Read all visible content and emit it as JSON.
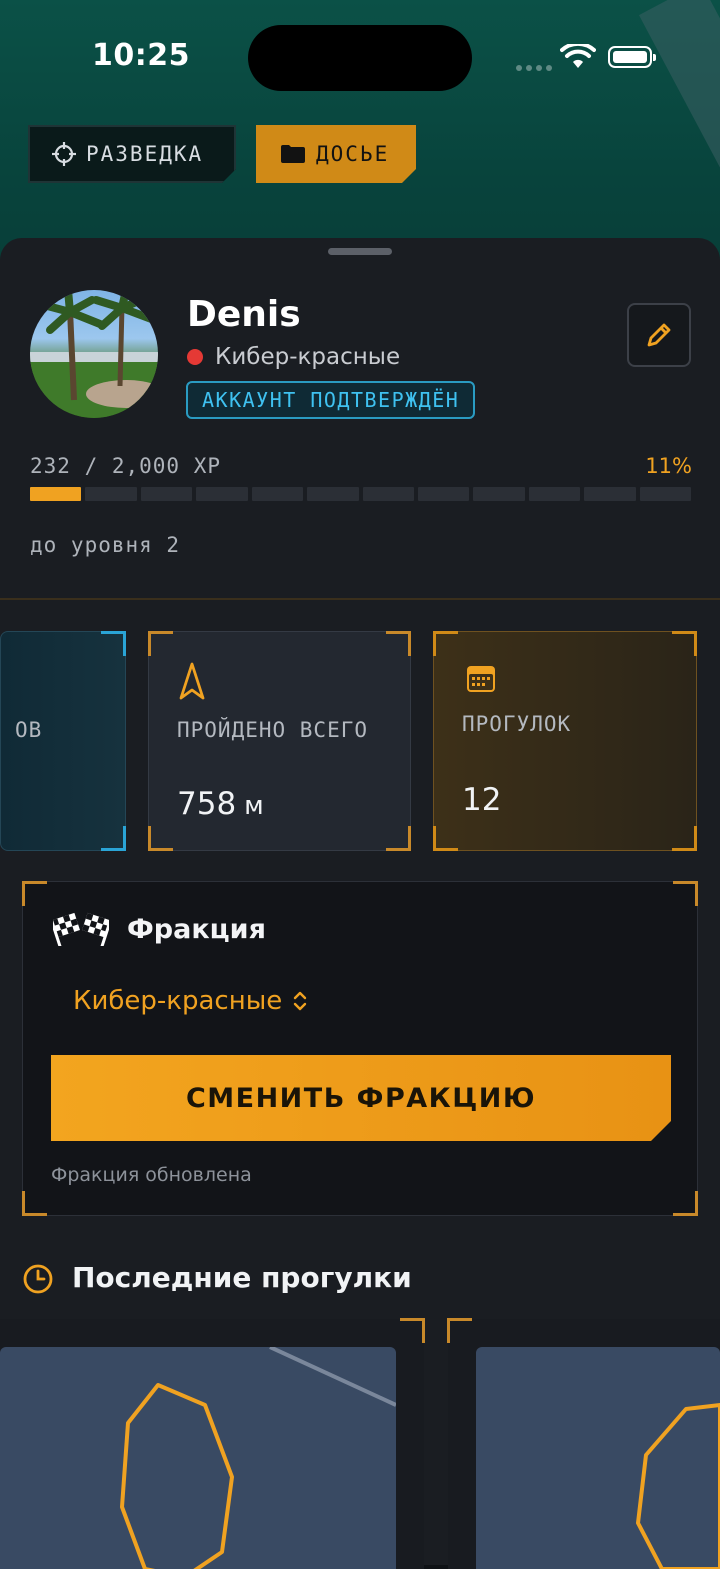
{
  "status_bar": {
    "time": "10:25"
  },
  "top_nav": {
    "recon_label": "РАЗВЕДКА",
    "dossier_label": "ДОСЬЕ"
  },
  "profile": {
    "name": "Denis",
    "faction": "Кибер-красные",
    "faction_color": "#e53935",
    "verified_badge": "АККАУНТ ПОДТВЕРЖДЁН"
  },
  "xp": {
    "text": "232 / 2,000 XP",
    "current": 232,
    "max": 2000,
    "percent_label": "11%",
    "progress_fraction": 0.11,
    "segments_total": 12,
    "segments_filled": 1,
    "next_level_text": "до уровня 2"
  },
  "stats": [
    {
      "label": "ОВ",
      "value": "",
      "unit": "",
      "accent": "blue"
    },
    {
      "label": "ПРОЙДЕНО ВСЕГО",
      "value": "758",
      "unit": "м",
      "icon": "navigation-arrow-icon",
      "accent": "grey"
    },
    {
      "label": "ПРОГУЛОК",
      "value": "12",
      "unit": "",
      "icon": "calendar-icon",
      "accent": "gold"
    }
  ],
  "faction_card": {
    "title": "Фракция",
    "selected": "Кибер-красные",
    "button_label": "СМЕНИТЬ ФРАКЦИЮ",
    "status_text": "Фракция обновлена"
  },
  "recent": {
    "title": "Последние прогулки"
  },
  "colors": {
    "accent": "#f0a221",
    "info": "#3fc1f0",
    "background": "#1a1d22"
  }
}
